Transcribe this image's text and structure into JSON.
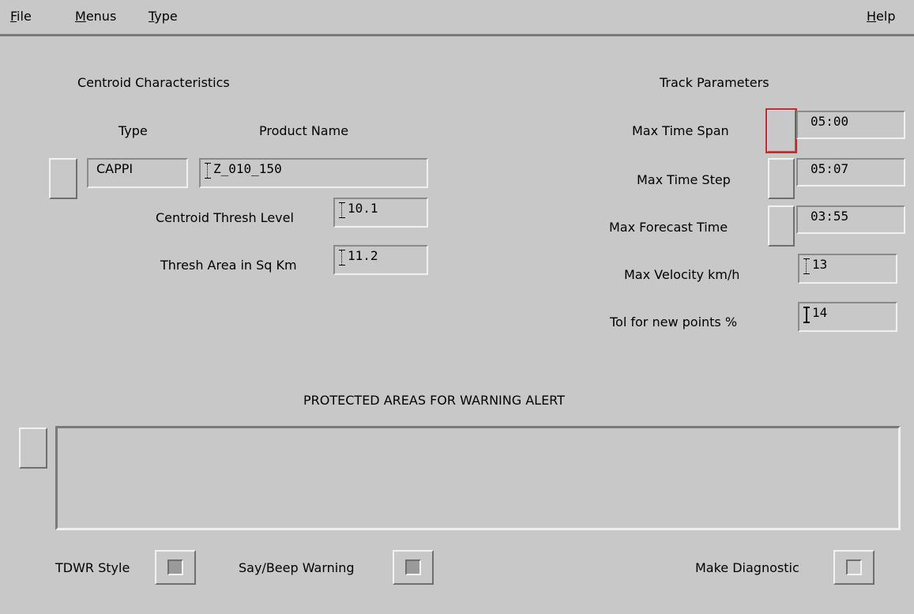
{
  "menubar": {
    "file": "File",
    "menus": "Menus",
    "type": "Type",
    "help": "Help"
  },
  "centroid": {
    "heading": "Centroid Characteristics",
    "type_header": "Type",
    "product_header": "Product Name",
    "type_value": "CAPPI",
    "product_value": "Z_010_150",
    "thresh_level_label": "Centroid Thresh Level",
    "thresh_level_value": "10.1",
    "thresh_area_label": "Thresh Area in Sq Km",
    "thresh_area_value": "11.2"
  },
  "track": {
    "heading": "Track Parameters",
    "max_time_span_label": "Max Time Span",
    "max_time_span_value": "05:00",
    "max_time_step_label": "Max Time Step",
    "max_time_step_value": "05:07",
    "max_forecast_label": "Max Forecast Time",
    "max_forecast_value": "03:55",
    "max_velocity_label": "Max Velocity km/h",
    "max_velocity_value": "13",
    "tol_label": "Tol for new points %",
    "tol_value": "14"
  },
  "protected": {
    "heading": "PROTECTED AREAS FOR WARNING ALERT",
    "text": ""
  },
  "options": {
    "tdwr_label": "TDWR Style",
    "tdwr_checked": true,
    "beep_label": "Say/Beep Warning",
    "beep_checked": true,
    "diag_label": "Make Diagnostic",
    "diag_checked": false
  }
}
